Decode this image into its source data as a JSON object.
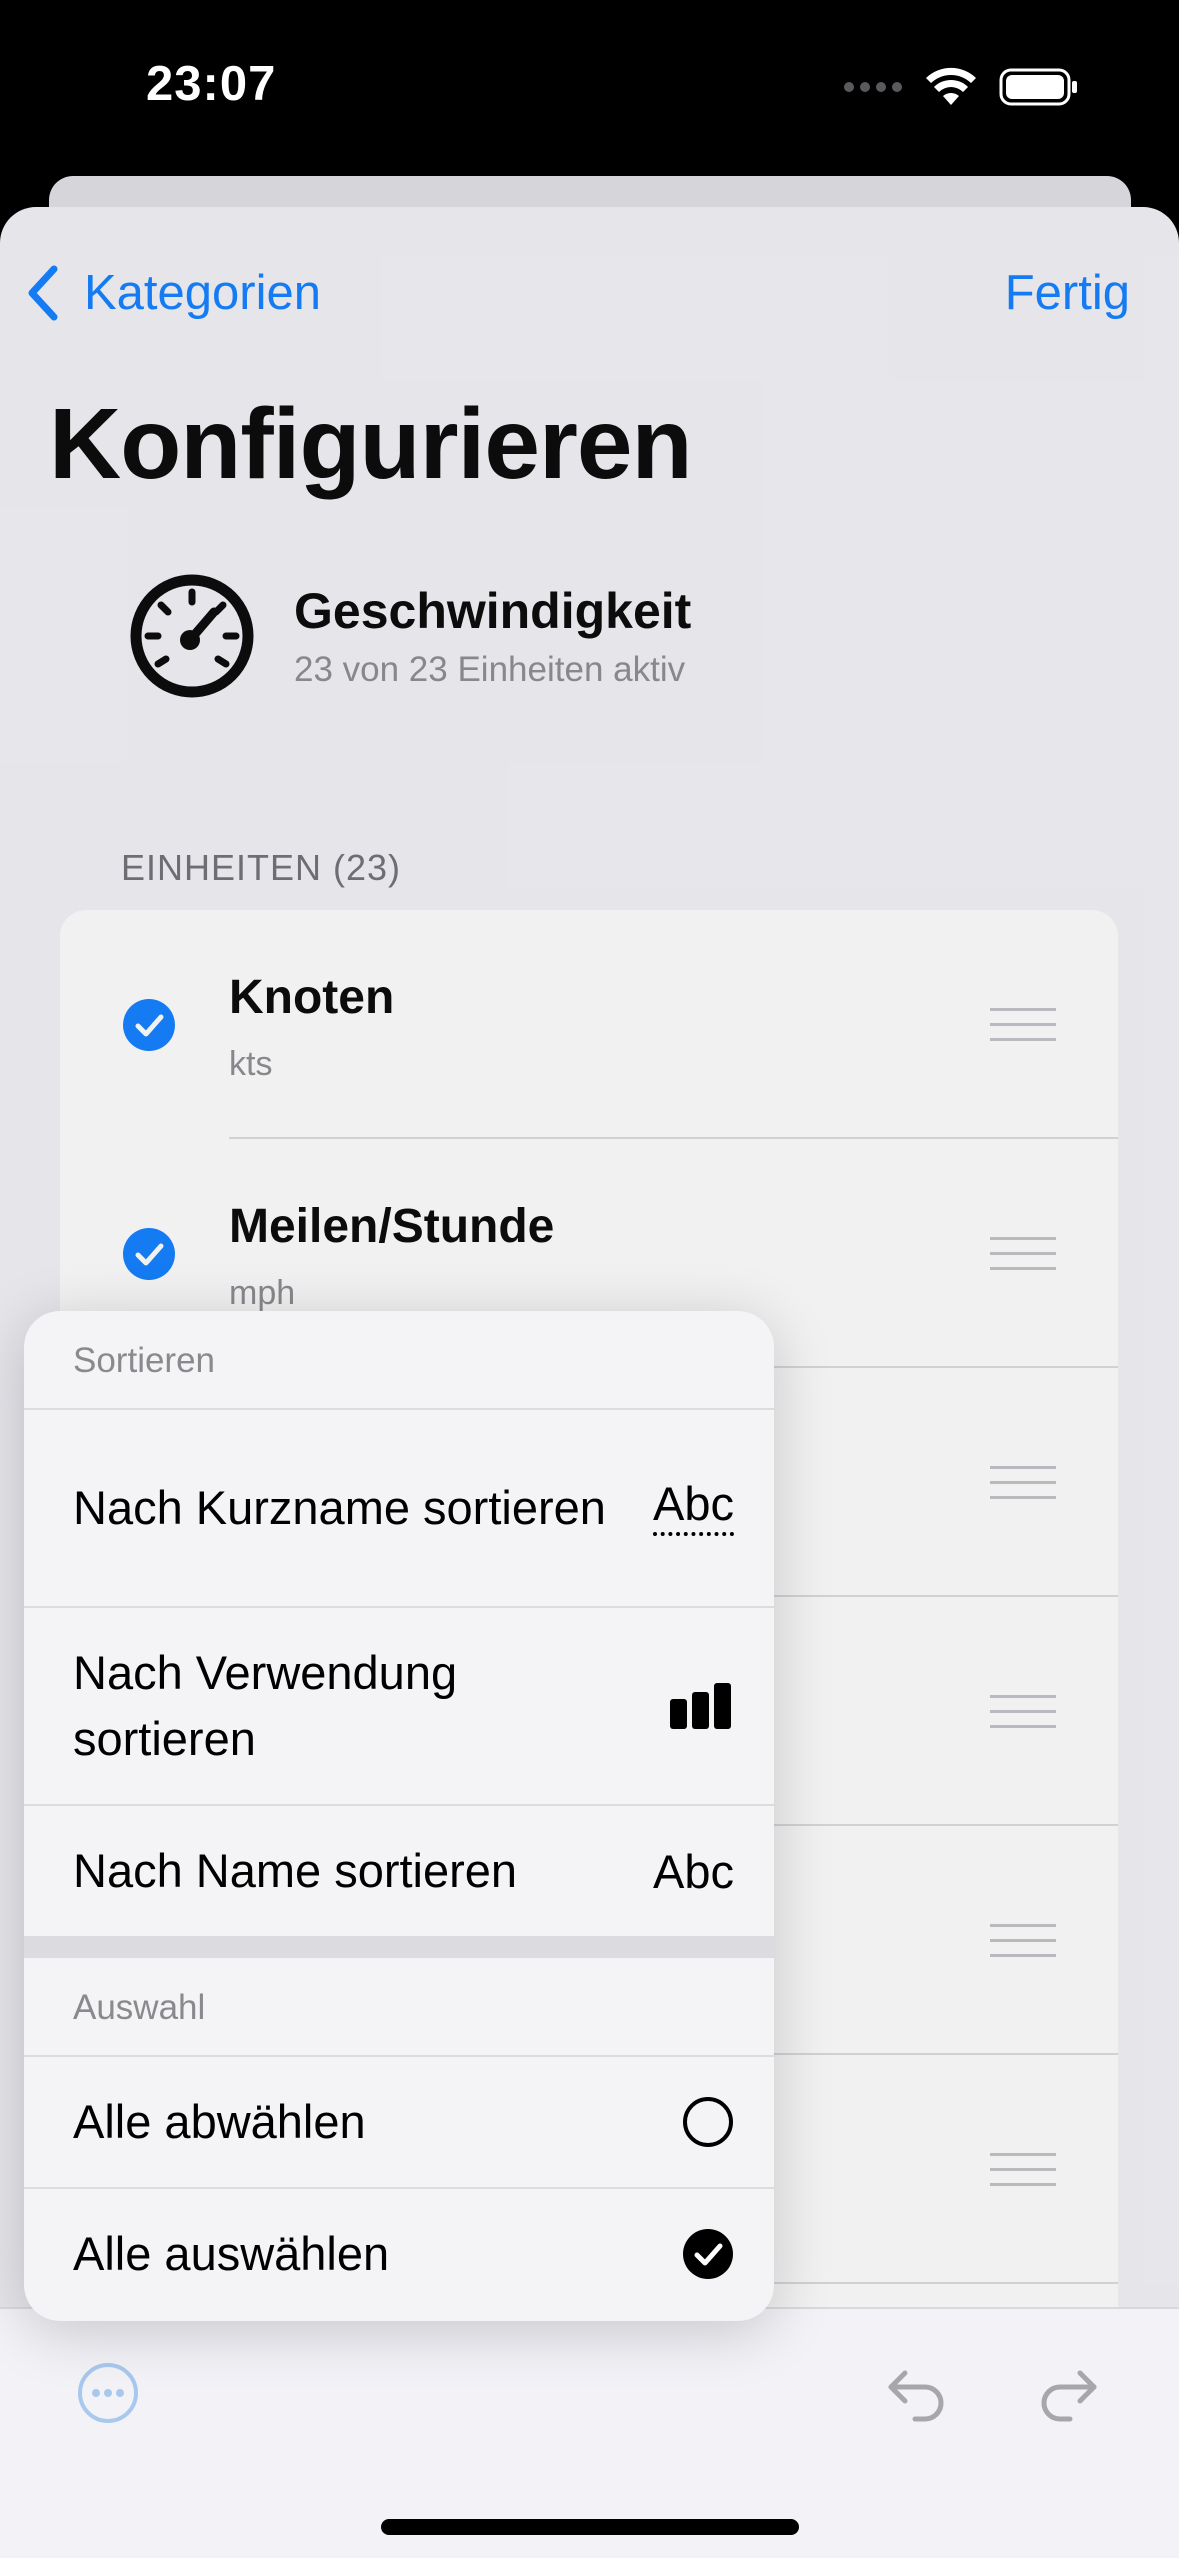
{
  "status_bar": {
    "time": "23:07"
  },
  "nav": {
    "back_label": "Kategorien",
    "done_label": "Fertig",
    "title": "Konfigurieren"
  },
  "category": {
    "name": "Geschwindigkeit",
    "subtitle": "23 von 23 Einheiten aktiv",
    "icon": "speedometer-icon"
  },
  "units_section": {
    "header": "EINHEITEN (23)",
    "units": [
      {
        "name": "Knoten",
        "abbr": "kts",
        "checked": true
      },
      {
        "name": "Meilen/Stunde",
        "abbr": "mph",
        "checked": true
      }
    ]
  },
  "menu": {
    "sort_header": "Sortieren",
    "sort_items": [
      {
        "label": "Nach Kurzname sortieren",
        "icon_text": "Abc",
        "icon": "abc-dotted-icon"
      },
      {
        "label": "Nach Verwendung sortieren",
        "icon": "bar-chart-icon"
      },
      {
        "label": "Nach Name sortieren",
        "icon_text": "Abc",
        "icon": "abc-icon"
      }
    ],
    "selection_header": "Auswahl",
    "selection_items": [
      {
        "label": "Alle abwählen",
        "icon": "empty-circle-icon"
      },
      {
        "label": "Alle auswählen",
        "icon": "checkmark-circle-icon"
      }
    ]
  },
  "toolbar": {
    "more_icon": "ellipsis-circle-icon",
    "undo_icon": "undo-icon",
    "redo_icon": "redo-icon"
  },
  "colors": {
    "accent": "#0a7cff",
    "background": "#f2f2f7"
  }
}
